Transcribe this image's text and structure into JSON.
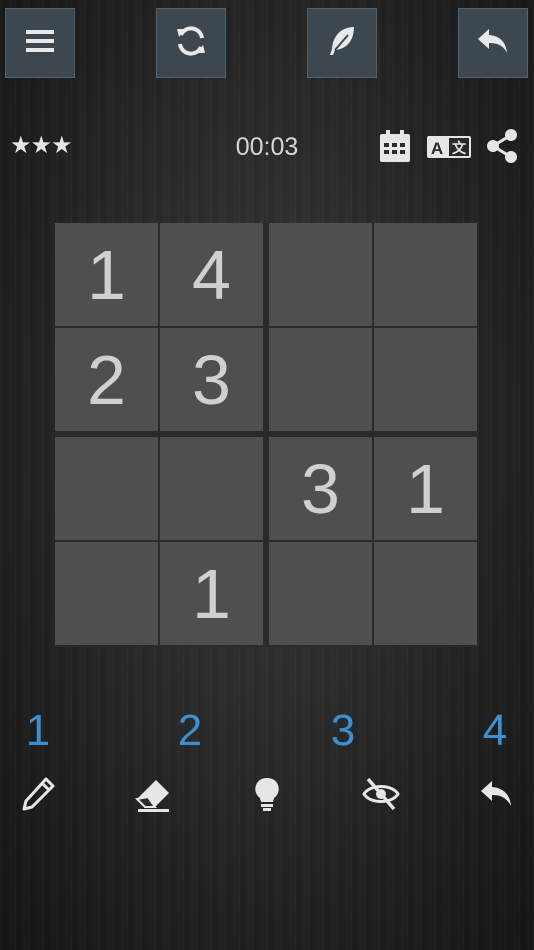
{
  "toolbar": {
    "buttons": [
      {
        "name": "menu-button",
        "icon": "menu-icon"
      },
      {
        "name": "restart-button",
        "icon": "refresh-icon"
      },
      {
        "name": "theme-button",
        "icon": "feather-icon"
      },
      {
        "name": "back-button",
        "icon": "back-arrow-icon"
      }
    ]
  },
  "status": {
    "difficulty": "★★★",
    "timer": "00:03",
    "icons": [
      "calendar-icon",
      "translate-icon",
      "share-icon"
    ]
  },
  "board": {
    "size": 4,
    "cells": [
      [
        "1",
        "4",
        "",
        ""
      ],
      [
        "2",
        "3",
        "",
        ""
      ],
      [
        "",
        "",
        "3",
        "1"
      ],
      [
        "",
        "1",
        "",
        ""
      ]
    ]
  },
  "numpad": [
    "1",
    "2",
    "3",
    "4"
  ],
  "tools": [
    "pencil-icon",
    "eraser-icon",
    "hint-bulb-icon",
    "hide-eye-icon",
    "undo-icon"
  ],
  "colors": {
    "accent": "#3c8fd0",
    "cell": "#4f4f4d",
    "button": "#3c4750"
  }
}
